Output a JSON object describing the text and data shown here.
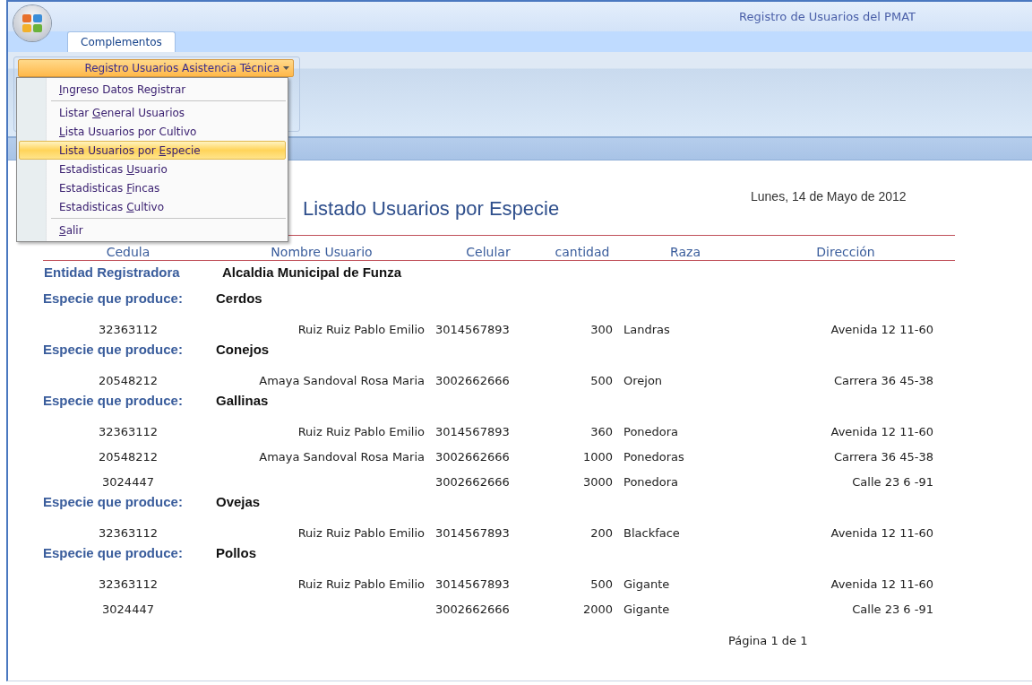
{
  "window": {
    "title": "Registro de Usuarios del PMAT"
  },
  "tabs": [
    {
      "label": "Complementos",
      "selected": true
    }
  ],
  "ribbon": {
    "dropdown_button": "Registro Usuarios Asistencia Técnica"
  },
  "menu": {
    "groups": [
      [
        {
          "key": "I",
          "after": "ngreso Datos Registrar",
          "selected": false
        }
      ],
      [
        {
          "before": "Listar ",
          "key": "G",
          "after": "eneral Usuarios",
          "selected": false
        },
        {
          "key": "L",
          "after": "ista Usuarios por Cultivo",
          "selected": false
        },
        {
          "before": "Lista Usuarios por ",
          "key": "E",
          "after": "specie",
          "selected": true
        },
        {
          "before": "Estadisticas ",
          "key": "U",
          "after": "suario",
          "selected": false
        },
        {
          "before": "Estadisticas ",
          "key": "F",
          "after": "incas",
          "selected": false
        },
        {
          "before": "Estadisticas ",
          "key": "C",
          "after": "ultivo",
          "selected": false
        }
      ],
      [
        {
          "key": "S",
          "after": "alir",
          "selected": false
        }
      ]
    ]
  },
  "report": {
    "title": "Listado Usuarios por Especie",
    "date": "Lunes, 14 de Mayo de 2012",
    "columns": [
      "Cedula",
      "Nombre Usuario",
      "Celular",
      "cantidad",
      "Raza",
      "Dirección"
    ],
    "entity_label": "Entidad Registradora",
    "entity_value": "Alcaldia Municipal de Funza",
    "groups": [
      {
        "label": "Especie que produce:",
        "value": "Cerdos",
        "rows": [
          [
            "32363112",
            "Ruiz Ruiz Pablo Emilio",
            "3014567893",
            "300",
            "Landras",
            "Avenida 12 11-60"
          ]
        ]
      },
      {
        "label": "Especie que produce:",
        "value": "Conejos",
        "rows": [
          [
            "20548212",
            "Amaya Sandoval Rosa Maria",
            "3002662666",
            "500",
            "Orejon",
            "Carrera 36 45-38"
          ]
        ]
      },
      {
        "label": "Especie que produce:",
        "value": "Gallinas",
        "rows": [
          [
            "32363112",
            "Ruiz Ruiz Pablo Emilio",
            "3014567893",
            "360",
            "Ponedora",
            "Avenida 12 11-60"
          ],
          [
            "20548212",
            "Amaya Sandoval Rosa Maria",
            "3002662666",
            "1000",
            "Ponedoras",
            "Carrera 36 45-38"
          ],
          [
            "3024447",
            "",
            "3002662666",
            "3000",
            "Ponedora",
            "Calle 23 6 -91"
          ]
        ]
      },
      {
        "label": "Especie que produce:",
        "value": "Ovejas",
        "rows": [
          [
            "32363112",
            "Ruiz Ruiz Pablo Emilio",
            "3014567893",
            "200",
            "Blackface",
            "Avenida 12 11-60"
          ]
        ]
      },
      {
        "label": "Especie que produce:",
        "value": "Pollos",
        "rows": [
          [
            "32363112",
            "Ruiz Ruiz Pablo Emilio",
            "3014567893",
            "500",
            "Gigante",
            "Avenida 12 11-60"
          ],
          [
            "3024447",
            "",
            "3002662666",
            "2000",
            "Gigante",
            "Calle 23 6 -91"
          ]
        ]
      }
    ],
    "footer": "Página 1 de 1"
  }
}
